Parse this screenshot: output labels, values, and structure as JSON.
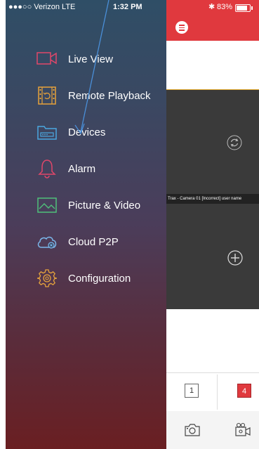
{
  "status": {
    "carrier": "●●●○○ Verizon  LTE",
    "time": "1:32 PM",
    "bluetooth": "✱",
    "battery_percent_text": "83%",
    "battery_level": 0.83
  },
  "menu": {
    "items": [
      {
        "label": "Live View",
        "icon": "live-view-camera-icon"
      },
      {
        "label": "Remote Playback",
        "icon": "playback-icon"
      },
      {
        "label": "Devices",
        "icon": "devices-icon"
      },
      {
        "label": "Alarm",
        "icon": "bell-icon"
      },
      {
        "label": "Picture & Video",
        "icon": "picture-icon"
      },
      {
        "label": "Cloud P2P",
        "icon": "cloud-icon"
      },
      {
        "label": "Configuration",
        "icon": "gear-icon"
      }
    ]
  },
  "main": {
    "tile_caption": "Trax - Camera 01 [Incorrect] user name",
    "split_one": "1",
    "split_four": "4"
  },
  "colors": {
    "accent": "#e0393e",
    "icon_pink": "#e2476a",
    "icon_orange": "#e8a23a",
    "icon_blue": "#4aa7e0",
    "icon_green": "#4fc07a",
    "icon_cloud": "#7bb8ec",
    "icon_gear": "#e6a33d"
  }
}
